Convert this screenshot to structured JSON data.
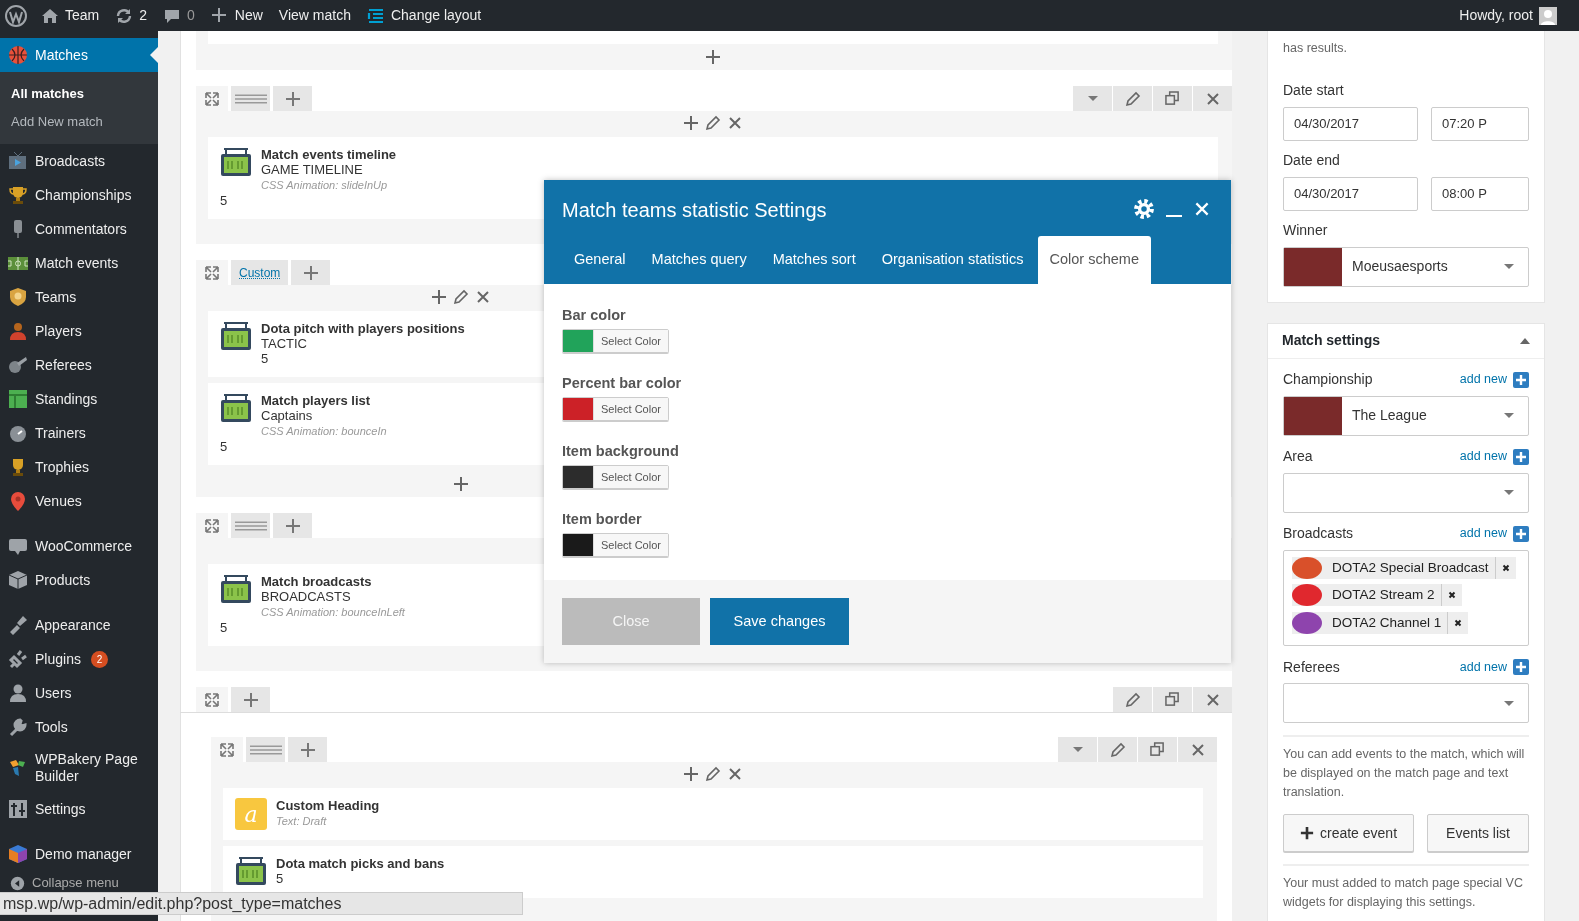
{
  "admin_bar": {
    "site": "Team",
    "updates": "2",
    "comments": "0",
    "new_label": "New",
    "view_label": "View match",
    "layout_label": "Change layout",
    "greeting": "Howdy, root"
  },
  "sidebar": {
    "groups": [
      [
        {
          "label": "Matches",
          "selected": true,
          "submenu": [
            {
              "label": "All matches",
              "selected": true
            },
            {
              "label": "Add New match",
              "selected": false
            }
          ]
        },
        {
          "label": "Broadcasts",
          "selected": false
        },
        {
          "label": "Championships",
          "selected": false
        },
        {
          "label": "Commentators",
          "selected": false
        },
        {
          "label": "Match events",
          "selected": false
        },
        {
          "label": "Teams",
          "selected": false
        },
        {
          "label": "Players",
          "selected": false
        },
        {
          "label": "Referees",
          "selected": false
        },
        {
          "label": "Standings",
          "selected": false
        },
        {
          "label": "Trainers",
          "selected": false
        },
        {
          "label": "Trophies",
          "selected": false
        },
        {
          "label": "Venues",
          "selected": false
        }
      ],
      [
        {
          "label": "WooCommerce",
          "selected": false
        },
        {
          "label": "Products",
          "selected": false
        }
      ],
      [
        {
          "label": "Appearance",
          "selected": false
        },
        {
          "label": "Plugins",
          "selected": false,
          "badge": "2"
        },
        {
          "label": "Users",
          "selected": false
        },
        {
          "label": "Tools",
          "selected": false
        },
        {
          "label": "WPBakery Page Builder",
          "selected": false
        },
        {
          "label": "Settings",
          "selected": false
        }
      ],
      [
        {
          "label": "Demo manager",
          "selected": false
        }
      ]
    ],
    "collapse": "Collapse menu"
  },
  "editor": {
    "rows": [
      {
        "kind": "tail"
      },
      {
        "kind": "row",
        "tabs": [
          {
            "kind": "expand"
          },
          {
            "kind": "handle"
          },
          {
            "kind": "add"
          }
        ],
        "tools": [
          {
            "kind": "caret"
          },
          {
            "kind": "edit"
          },
          {
            "kind": "clone"
          },
          {
            "kind": "delete"
          }
        ],
        "columns": [
          {
            "column_tools": true,
            "add_below": false,
            "elements": [
              {
                "kind": "widget",
                "title": "Match events timeline",
                "subtitle": "GAME TIMELINE",
                "note": "CSS Animation: slideInUp",
                "value": "5"
              }
            ]
          }
        ]
      },
      {
        "kind": "row",
        "tabs": [
          {
            "kind": "expand"
          },
          {
            "kind": "link",
            "label": "Custom"
          },
          {
            "kind": "add"
          }
        ],
        "tools": [],
        "columns": [
          {
            "column_tools": true,
            "add_below": true,
            "elements": [
              {
                "kind": "widget",
                "title": "Dota pitch with players positions",
                "subtitle": "TACTIC",
                "value": "5"
              },
              {
                "kind": "widget",
                "title": "Match players list",
                "subtitle": "Captains",
                "note": "CSS Animation: bounceIn",
                "value": "5"
              }
            ]
          },
          {}
        ]
      },
      {
        "kind": "row",
        "tabs": [
          {
            "kind": "expand"
          },
          {
            "kind": "handle"
          },
          {
            "kind": "add"
          }
        ],
        "tools": [],
        "columns": [
          {
            "add_below": false,
            "elements": [
              {
                "kind": "widget",
                "title": "Match broadcasts",
                "subtitle": "BROADCASTS",
                "note": "CSS Animation: bounceInLeft",
                "value": "5"
              }
            ]
          }
        ]
      },
      {
        "kind": "section",
        "tabs": [
          {
            "kind": "expand"
          },
          {
            "kind": "add"
          }
        ],
        "tools": [
          {
            "kind": "edit"
          },
          {
            "kind": "clone"
          },
          {
            "kind": "delete"
          }
        ],
        "rows": [
          {
            "kind": "row",
            "tabs": [
              {
                "kind": "expand"
              },
              {
                "kind": "handle"
              },
              {
                "kind": "add"
              }
            ],
            "tools": [
              {
                "kind": "caret"
              },
              {
                "kind": "edit"
              },
              {
                "kind": "clone"
              },
              {
                "kind": "delete"
              }
            ],
            "columns": [
              {
                "column_tools": true,
                "add_below": false,
                "elements": [
                  {
                    "kind": "heading",
                    "icon_text": "a",
                    "title": "Custom Heading",
                    "note": "Text: Draft"
                  },
                  {
                    "kind": "widget",
                    "title": "Dota match picks and bans",
                    "value": "5"
                  }
                ]
              }
            ]
          }
        ]
      }
    ]
  },
  "modal": {
    "title": "Match teams statistic Settings",
    "tabs": [
      {
        "label": "General",
        "selected": false
      },
      {
        "label": "Matches query",
        "selected": false
      },
      {
        "label": "Matches sort",
        "selected": false
      },
      {
        "label": "Organisation statistics",
        "selected": false
      },
      {
        "label": "Color scheme",
        "selected": true
      }
    ],
    "fields": [
      {
        "label": "Bar color",
        "button": "Select Color",
        "color": "#21a35a"
      },
      {
        "label": "Percent bar color",
        "button": "Select Color",
        "color": "#cc2127"
      },
      {
        "label": "Item background",
        "button": "Select Color",
        "color": "#2c2c2c"
      },
      {
        "label": "Item border",
        "button": "Select Color",
        "color": "#1a1a1a"
      }
    ],
    "close_label": "Close",
    "save_label": "Save changes"
  },
  "meta": {
    "date_box": {
      "note": "has results.",
      "start_label": "Date start",
      "start_date": "04/30/2017",
      "start_time": "07:20 P",
      "end_label": "Date end",
      "end_date": "04/30/2017",
      "end_time": "08:00 P",
      "winner_label": "Winner",
      "winner": "Moeusaesports"
    },
    "settings_box": {
      "title": "Match settings",
      "expanded": true,
      "fields": [
        {
          "kind": "select",
          "label": "Championship",
          "add_label": "add new",
          "value": "The League"
        },
        {
          "kind": "select",
          "label": "Area",
          "add_label": "add new"
        },
        {
          "kind": "tags",
          "label": "Broadcasts",
          "add_label": "add new",
          "tags": [
            {
              "label": "DOTA2 Special Broadcast",
              "color": "#d9502a"
            },
            {
              "label": "DOTA2 Stream 2",
              "color": "#e0282e"
            },
            {
              "label": "DOTA2 Channel 1",
              "color": "#8e44ad"
            }
          ]
        },
        {
          "kind": "select",
          "label": "Referees",
          "add_label": "add new"
        }
      ],
      "events_note": "You can add events to the match, which will be displayed on the match page and text translation.",
      "create_label": "create event",
      "list_label": "Events list",
      "footer_note": "Your must added to match page special VC widgets for displaying this settings."
    }
  },
  "status_url": "msp.wp/wp-admin/edit.php?post_type=matches"
}
